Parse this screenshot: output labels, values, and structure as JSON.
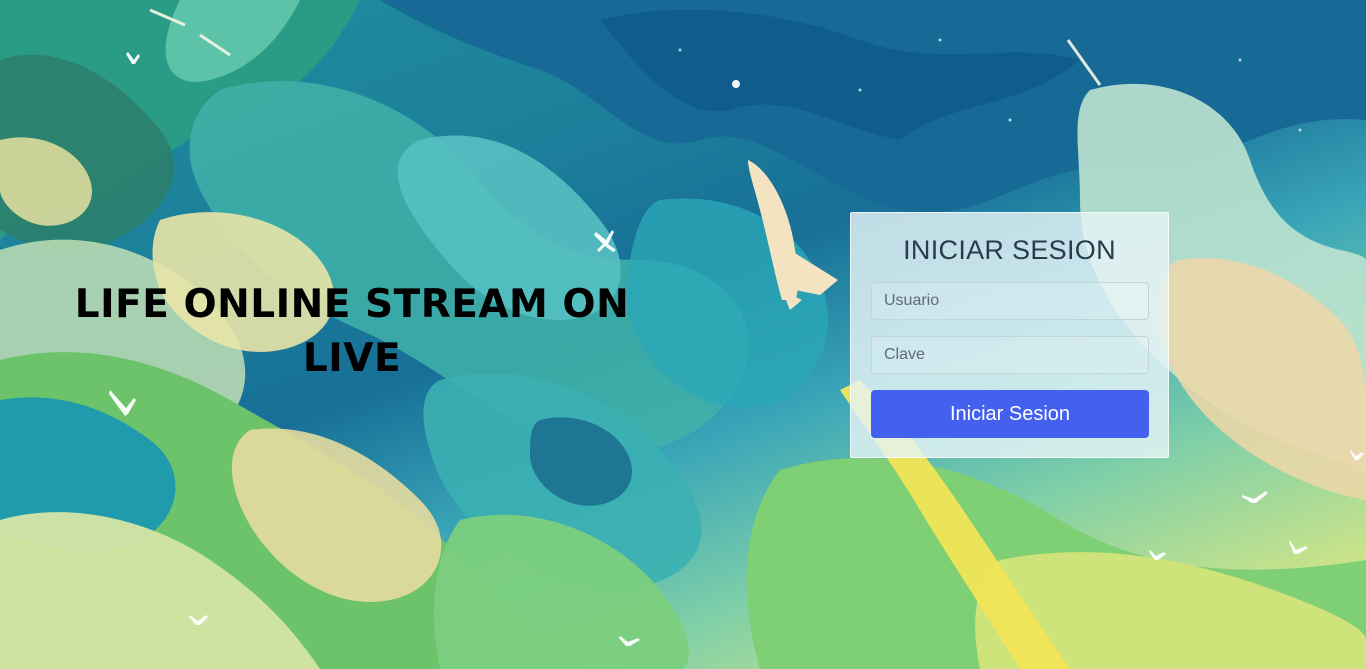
{
  "headline": {
    "line1": "LIFE ONLINE STREAM ON",
    "line2": "LIVE"
  },
  "login": {
    "title": "INICIAR SESION",
    "username_placeholder": "Usuario",
    "password_placeholder": "Clave",
    "submit_label": "Iniciar Sesion"
  },
  "colors": {
    "button": "#4360ee",
    "panel": "#e6f4f7",
    "title_text": "#2b3a4e"
  },
  "background": {
    "description_icon": "watercolor-sky-illustration"
  }
}
